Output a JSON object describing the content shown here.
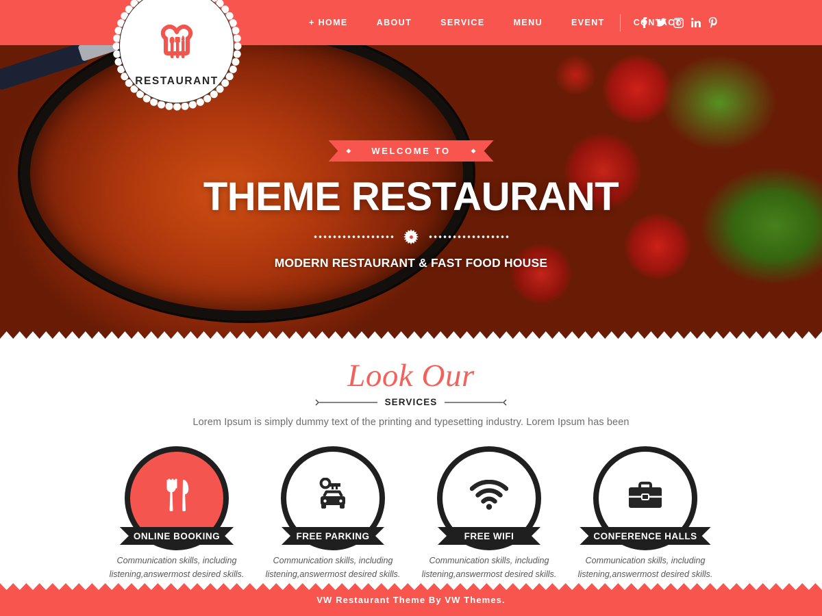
{
  "colors": {
    "brand": "#f9554f",
    "brand_light": "#f0635c",
    "dark": "#1f1f1f",
    "body_text": "#6d6d6d"
  },
  "header": {
    "logo": {
      "text": "RESTAURANT",
      "icon": "chef-hat-cutlery-logo"
    },
    "nav": [
      {
        "label": "+ HOME",
        "name": "nav-item-home"
      },
      {
        "label": "ABOUT",
        "name": "nav-item-about"
      },
      {
        "label": "SERVICE",
        "name": "nav-item-service"
      },
      {
        "label": "MENU",
        "name": "nav-item-menu"
      },
      {
        "label": "EVENT",
        "name": "nav-item-event"
      },
      {
        "label": "CONTACT",
        "name": "nav-item-contact"
      }
    ],
    "social": [
      {
        "icon": "facebook-icon",
        "label": "f"
      },
      {
        "icon": "twitter-icon",
        "label": "twitter"
      },
      {
        "icon": "instagram-icon",
        "label": "instagram"
      },
      {
        "icon": "linkedin-icon",
        "label": "in"
      },
      {
        "icon": "pinterest-icon",
        "label": "P"
      }
    ]
  },
  "hero": {
    "ribbon_text": "WELCOME TO",
    "ribbon_diamond_left": "◆",
    "ribbon_diamond_right": "◆",
    "title": "THEME RESTAURANT",
    "subtitle": "MODERN RESTAURANT & FAST FOOD HOUSE",
    "divider_icon": "starburst-icon"
  },
  "services": {
    "title_script": "Look Our",
    "title_label": "SERVICES",
    "description": "Lorem Ipsum is simply dummy text of the printing and typesetting industry. Lorem Ipsum has been",
    "cards": [
      {
        "title": "ONLINE BOOKING",
        "text": "Communication skills, including listening,answermost desired skills.",
        "icon": "fork-knife-icon",
        "filled": true
      },
      {
        "title": "FREE PARKING",
        "text": "Communication skills, including listening,answermost desired skills.",
        "icon": "car-key-icon",
        "filled": false
      },
      {
        "title": "FREE WIFI",
        "text": "Communication skills, including listening,answermost desired skills.",
        "icon": "wifi-icon",
        "filled": false
      },
      {
        "title": "CONFERENCE HALLS",
        "text": "Communication skills, including listening,answermost desired skills.",
        "icon": "briefcase-icon",
        "filled": false
      }
    ]
  },
  "footer": {
    "text": "VW Restaurant Theme By VW Themes."
  }
}
